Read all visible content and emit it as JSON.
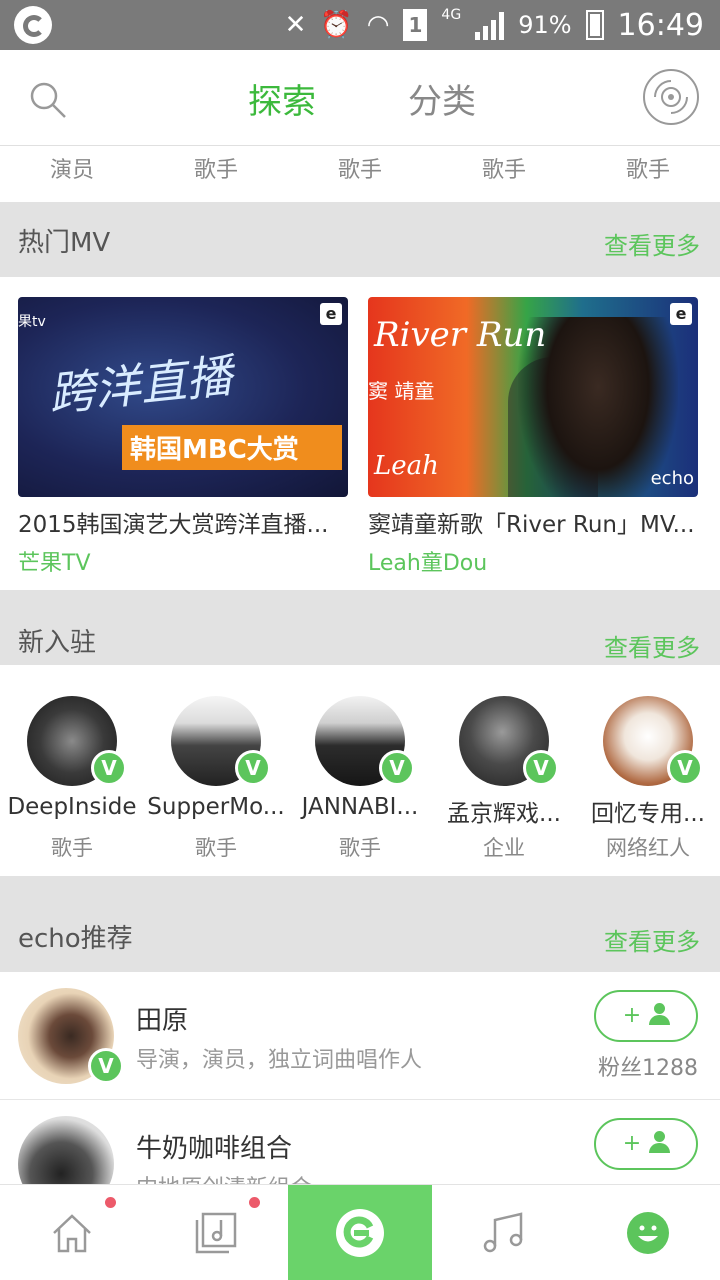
{
  "status_bar": {
    "network": "4G",
    "sim_slot": "1",
    "battery": "91%",
    "time": "16:49"
  },
  "header": {
    "tab_explore": "探索",
    "tab_category": "分类"
  },
  "categories": [
    "演员",
    "歌手",
    "歌手",
    "歌手",
    "歌手"
  ],
  "hot_mv": {
    "title": "热门MV",
    "more": "查看更多",
    "items": [
      {
        "title": "2015韩国演艺大赏跨洋直播...",
        "author": "芒果TV",
        "thumb_tag": "果tv",
        "thumb_text": "跨洋直播",
        "thumb_sub": "韩国MBC大赏"
      },
      {
        "title": "窦靖童新歌「River Run」MV...",
        "author": "Leah童Dou",
        "thumb_script": "River Run",
        "thumb_note": "窦 靖童",
        "thumb_script2": "Leah",
        "thumb_brand": "echo"
      }
    ]
  },
  "new_arrivals": {
    "title": "新入驻",
    "more": "查看更多",
    "items": [
      {
        "name": "DeepInside",
        "role": "歌手"
      },
      {
        "name": "SupperMo...",
        "role": "歌手"
      },
      {
        "name": "JANNABI...",
        "role": "歌手"
      },
      {
        "name": "孟京辉戏...",
        "role": "企业"
      },
      {
        "name": "回忆专用...",
        "role": "网络红人"
      }
    ]
  },
  "echo_recommend": {
    "title": "echo推荐",
    "more": "查看更多",
    "items": [
      {
        "name": "田原",
        "desc": "导演，演员，独立词曲唱作人",
        "fans": "粉丝1288",
        "follow": "+"
      },
      {
        "name": "牛奶咖啡组合",
        "desc": "内地原创清新组合",
        "fans": "",
        "follow": "+"
      }
    ]
  },
  "badge_letter": "V",
  "colors": {
    "accent": "#5cc55c",
    "active_tab": "#3cb93c",
    "nav_active_bg": "#6ad36a",
    "notify_dot": "#ec5a6a"
  },
  "bottom_nav": [
    "home-icon",
    "playlist-icon",
    "echo-icon",
    "music-note-icon",
    "profile-face-icon"
  ]
}
